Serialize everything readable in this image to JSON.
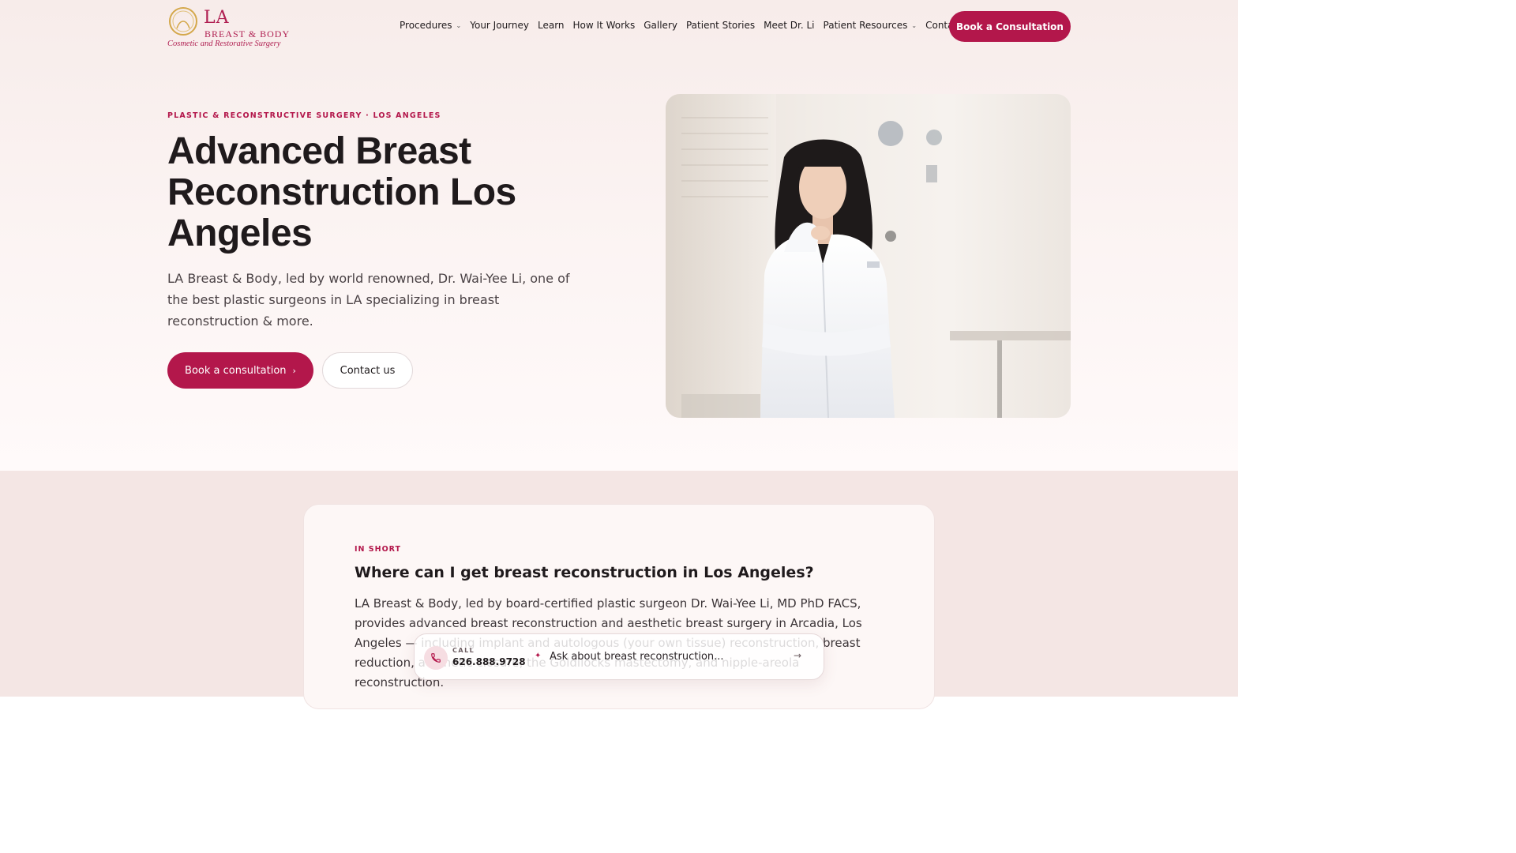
{
  "logo": {
    "mark": "LA",
    "name": "BREAST & BODY",
    "tagline": "Cosmetic and Restorative Surgery",
    "icon": "logo-ring-icon"
  },
  "nav": {
    "items": [
      {
        "label": "Procedures",
        "dropdown": true
      },
      {
        "label": "Your Journey",
        "dropdown": false
      },
      {
        "label": "Learn",
        "dropdown": false
      },
      {
        "label": "How It Works",
        "dropdown": false
      },
      {
        "label": "Gallery",
        "dropdown": false
      },
      {
        "label": "Patient Stories",
        "dropdown": false
      },
      {
        "label": "Meet Dr. Li",
        "dropdown": false
      },
      {
        "label": "Patient Resources",
        "dropdown": true
      },
      {
        "label": "Contact",
        "dropdown": false
      }
    ],
    "cta": "Book a Consultation"
  },
  "hero": {
    "eyebrow": "PLASTIC & RECONSTRUCTIVE SURGERY · LOS ANGELES",
    "title": "Advanced Breast Reconstruction Los Angeles",
    "description": "LA Breast & Body, led by world renowned, Dr. Wai-Yee Li, one of the best plastic surgeons in LA specializing in breast reconstruction & more.",
    "primary_button": "Book a consultation",
    "primary_arrow": "›",
    "secondary_button": "Contact us"
  },
  "summary": {
    "eyebrow": "IN SHORT",
    "title": "Where can I get breast reconstruction in Los Angeles?",
    "text": "LA Breast & Body, led by board-certified plastic surgeon Dr. Wai-Yee Li, MD PhD FACS, provides advanced breast reconstruction and aesthetic breast surgery in Arcadia, Los Angeles — including implant and autologous (your own tissue) reconstruction, breast reduction, aesthetic closure, the Goldilocks mastectomy, and nipple-areola reconstruction."
  },
  "float_bar": {
    "call_label": "CALL",
    "phone": "626.888.9728",
    "ask_placeholder": "Ask about breast reconstruction...",
    "arrow": "→"
  },
  "colors": {
    "brand": "#b3174b",
    "hero_bg": "#f7ecea",
    "section_bg": "#f4e6e4"
  }
}
